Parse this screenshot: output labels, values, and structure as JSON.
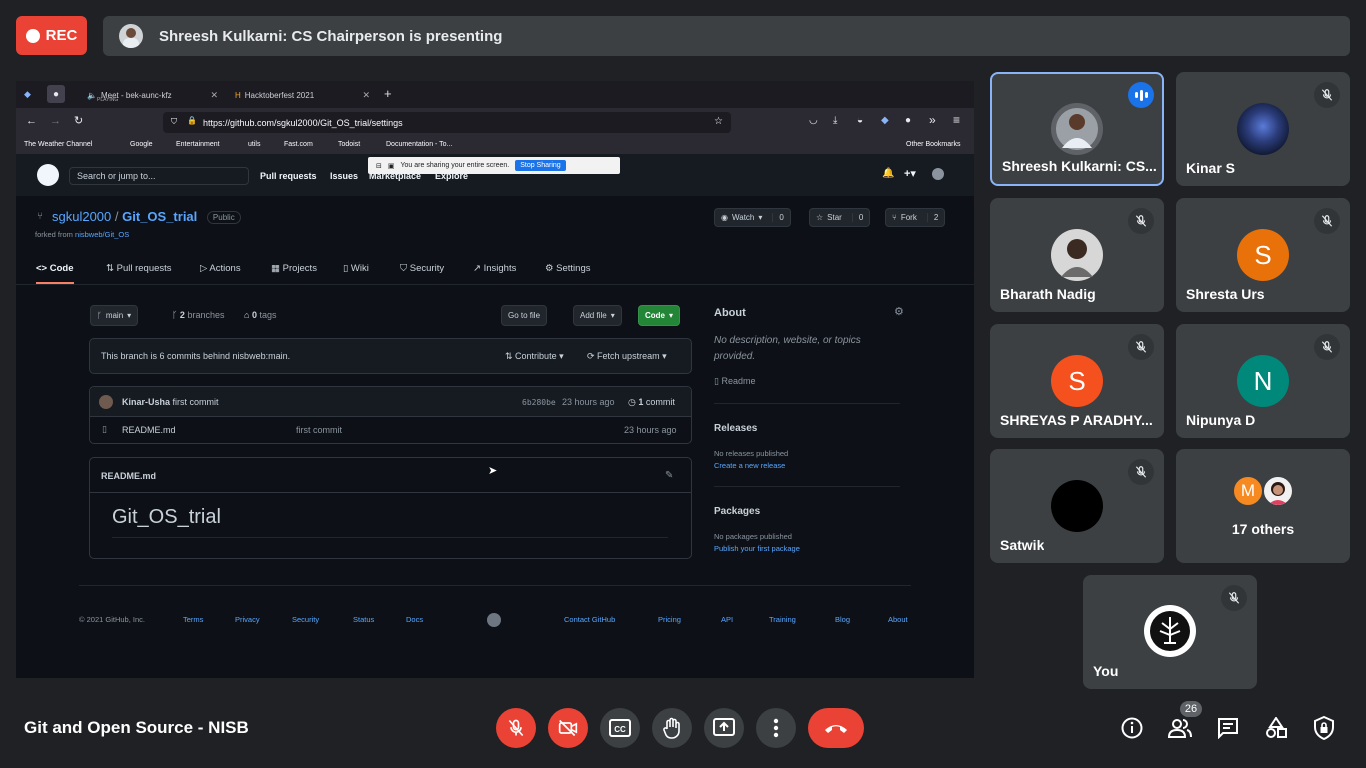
{
  "recording": {
    "label": "REC",
    "color": "#ea4335"
  },
  "presenting_banner": {
    "text": "Shreesh Kulkarni: CS Chairperson is presenting"
  },
  "browser": {
    "tabs": [
      {
        "label": "Meet - bek-aunc-kfz",
        "sub": "PLAYING"
      },
      {
        "label": "Hacktoberfest 2021"
      }
    ],
    "url": "https://github.com/sgkul2000/Git_OS_trial/settings",
    "bookmarks": [
      "The Weather Channel",
      "Google",
      "Entertainment",
      "utils",
      "Fast.com",
      "Todoist",
      "Documentation - To...",
      "Other Bookmarks"
    ]
  },
  "share_banner": {
    "text": "You are sharing your entire screen.",
    "stop_label": "Stop Sharing"
  },
  "github": {
    "search_placeholder": "Search or jump to...",
    "nav": [
      "Pull requests",
      "Issues",
      "Marketplace",
      "Explore"
    ],
    "owner": "sgkul2000",
    "repo": "Git_OS_trial",
    "visibility": "Public",
    "forked_prefix": "forked from",
    "forked_from": "nisbweb/Git_OS",
    "watch": {
      "label": "Watch",
      "count": "0"
    },
    "star": {
      "label": "Star",
      "count": "0"
    },
    "fork": {
      "label": "Fork",
      "count": "2"
    },
    "tabs": [
      "Code",
      "Pull requests",
      "Actions",
      "Projects",
      "Wiki",
      "Security",
      "Insights",
      "Settings"
    ],
    "branch": "main",
    "branches_count": "2",
    "branches_label": "branches",
    "tags_count": "0",
    "tags_label": "tags",
    "go_to_file": "Go to file",
    "add_file": "Add file",
    "code_btn": "Code",
    "behind_text": "This branch is 6 commits behind nisbweb:main.",
    "contribute": "Contribute",
    "fetch_upstream": "Fetch upstream",
    "commit": {
      "author": "Kinar-Usha",
      "message": "first commit",
      "sha": "6b280be",
      "time": "23 hours ago",
      "count": "1",
      "count_label": "commit"
    },
    "files": [
      {
        "name": "README.md",
        "message": "first commit",
        "time": "23 hours ago"
      }
    ],
    "readme_label": "README.md",
    "readme_heading": "Git_OS_trial",
    "about_title": "About",
    "about_desc": "No description, website, or topics provided.",
    "about_readme": "Readme",
    "releases_title": "Releases",
    "releases_none": "No releases published",
    "releases_link": "Create a new release",
    "packages_title": "Packages",
    "packages_none": "No packages published",
    "packages_link": "Publish your first package",
    "footer_copy": "© 2021 GitHub, Inc.",
    "footer_links": [
      "Terms",
      "Privacy",
      "Security",
      "Status",
      "Docs",
      "Contact GitHub",
      "Pricing",
      "API",
      "Training",
      "Blog",
      "About"
    ]
  },
  "participants": [
    {
      "name": "Shreesh Kulkarni: CS...",
      "avatar": "photo",
      "speaking": true
    },
    {
      "name": "Kinar S",
      "avatar": "photo",
      "muted": true
    },
    {
      "name": "Bharath Nadig",
      "avatar": "photo",
      "muted": true
    },
    {
      "name": "Shresta Urs",
      "avatar_letter": "S",
      "avatar_color": "#e8710a",
      "muted": true
    },
    {
      "name": "SHREYAS P ARADHY...",
      "avatar_letter": "S",
      "avatar_color": "#f4511e",
      "muted": true
    },
    {
      "name": "Nipunya D",
      "avatar_letter": "N",
      "avatar_color": "#00897b",
      "muted": true
    },
    {
      "name": "Satwik",
      "avatar": "black",
      "muted": true
    },
    {
      "name": "17 others",
      "avatar_letter": "M",
      "avatar_color": "#f6891f"
    },
    {
      "name": "You",
      "avatar": "logo",
      "muted": true
    }
  ],
  "meeting_title": "Git and Open Source - NISB",
  "people_count": "26",
  "controls": [
    "mic-off-icon",
    "camera-off-icon",
    "captions-icon",
    "raise-hand-icon",
    "present-icon",
    "more-options-icon",
    "hang-up-icon"
  ],
  "right_controls": [
    "info-icon",
    "people-icon",
    "chat-icon",
    "activities-icon",
    "host-controls-icon"
  ]
}
